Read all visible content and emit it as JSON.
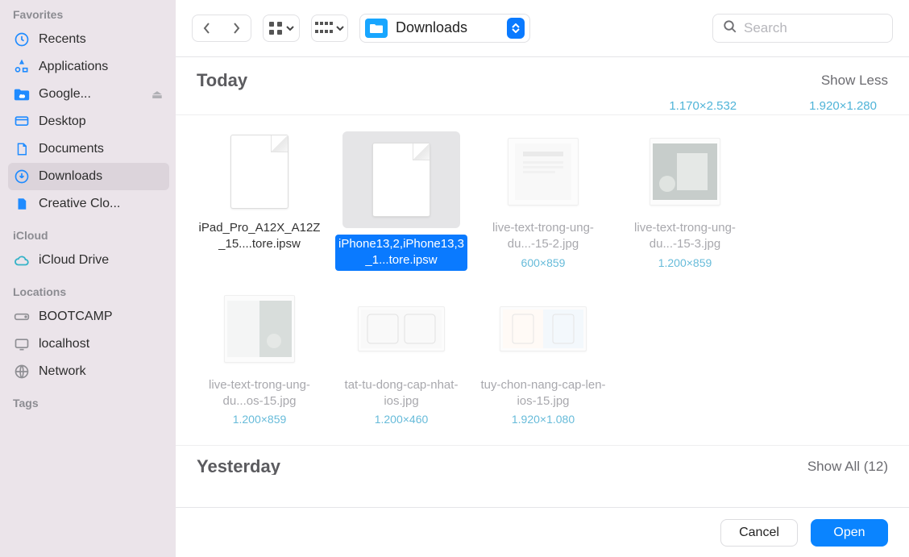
{
  "sidebar": {
    "sections": [
      {
        "heading": "Favorites",
        "items": [
          {
            "label": "Recents",
            "icon": "clock-icon",
            "selected": false
          },
          {
            "label": "Applications",
            "icon": "apps-icon",
            "selected": false
          },
          {
            "label": "Google...",
            "icon": "folder-cloud-icon",
            "selected": false,
            "ejectable": true
          },
          {
            "label": "Desktop",
            "icon": "desktop-icon",
            "selected": false
          },
          {
            "label": "Documents",
            "icon": "document-icon",
            "selected": false
          },
          {
            "label": "Downloads",
            "icon": "download-icon",
            "selected": true
          },
          {
            "label": "Creative Clo...",
            "icon": "file-icon",
            "selected": false
          }
        ]
      },
      {
        "heading": "iCloud",
        "items": [
          {
            "label": "iCloud Drive",
            "icon": "cloud-icon",
            "selected": false
          }
        ]
      },
      {
        "heading": "Locations",
        "items": [
          {
            "label": "BOOTCAMP",
            "icon": "disk-icon",
            "selected": false
          },
          {
            "label": "localhost",
            "icon": "display-icon",
            "selected": false
          },
          {
            "label": "Network",
            "icon": "globe-icon",
            "selected": false
          }
        ]
      },
      {
        "heading": "Tags",
        "items": []
      }
    ]
  },
  "toolbar": {
    "location_label": "Downloads",
    "search_placeholder": "Search"
  },
  "content": {
    "peek_dims": [
      "1.170×2.532",
      "1.920×1.280"
    ],
    "sections": [
      {
        "title": "Today",
        "toggle": "Show Less",
        "items": [
          {
            "kind": "doc",
            "label": "iPad_Pro_A12X_A12Z_15....tore.ipsw",
            "selected": false
          },
          {
            "kind": "doc",
            "label": "iPhone13,2,iPhone13,3_1...tore.ipsw",
            "selected": true
          },
          {
            "kind": "img",
            "label": "live-text-trong-ung-du...-15-2.jpg",
            "dims": "600×859",
            "dimmed": true
          },
          {
            "kind": "img",
            "label": "live-text-trong-ung-du...-15-3.jpg",
            "dims": "1.200×859",
            "dimmed": true
          },
          {
            "kind": "img",
            "label": "live-text-trong-ung-du...os-15.jpg",
            "dims": "1.200×859",
            "dimmed": true
          },
          {
            "kind": "img",
            "label": "tat-tu-dong-cap-nhat-ios.jpg",
            "dims": "1.200×460",
            "dimmed": true,
            "small": true
          },
          {
            "kind": "img",
            "label": "tuy-chon-nang-cap-len-ios-15.jpg",
            "dims": "1.920×1.080",
            "dimmed": true,
            "small": true
          }
        ]
      },
      {
        "title": "Yesterday",
        "toggle": "Show All (12)",
        "items": []
      }
    ]
  },
  "footer": {
    "cancel": "Cancel",
    "open": "Open"
  }
}
